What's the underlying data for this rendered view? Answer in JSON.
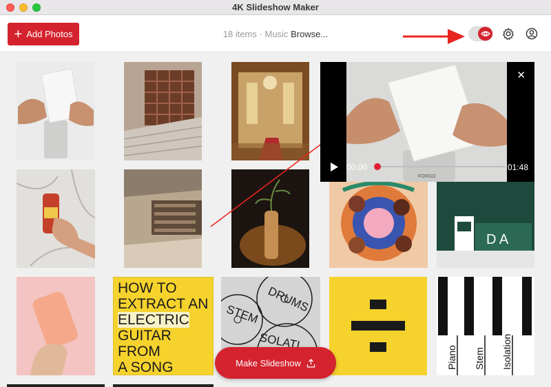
{
  "window": {
    "title": "4K Slideshow Maker"
  },
  "toolbar": {
    "add_photos_label": "Add Photos",
    "items_count": "18 items",
    "separator": "·",
    "music_label": "Music",
    "browse_label": "Browse...",
    "icons": [
      "eye-icon",
      "gear-icon",
      "account-icon"
    ]
  },
  "preview": {
    "current_time": "00:00",
    "duration": "01:48",
    "progress": 0
  },
  "tiles": {
    "guitar_text": [
      "HOW TO",
      "EXTRACT AN",
      "ELECTRIC",
      "GUITAR",
      "FROM",
      "A SONG"
    ],
    "drums_words": [
      "STEM",
      "DRUMS",
      "SOLATI"
    ],
    "piano_words": [
      "Piano",
      "Stem",
      "Isolation"
    ],
    "forgo_label": "FORGO",
    "da_label": "D A"
  },
  "footer": {
    "make_slideshow_label": "Make Slideshow"
  },
  "colors": {
    "accent": "#d4232f",
    "yellow": "#f6d22d"
  }
}
